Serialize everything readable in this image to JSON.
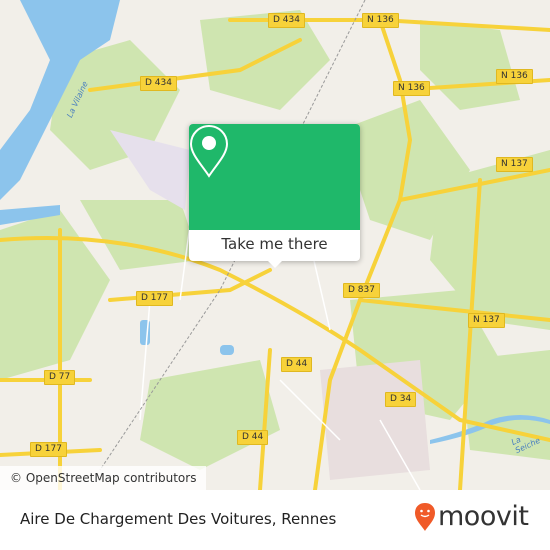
{
  "map": {
    "road_labels": [
      "D 434",
      "N 136",
      "N 136",
      "N 136",
      "D 434",
      "N 137",
      "D 177",
      "D 837",
      "N 137",
      "D 44",
      "D 77",
      "D 34",
      "D 44",
      "D 177"
    ],
    "water_labels": [
      "La Vilaine",
      "La Seiche"
    ],
    "attribution": "© OpenStreetMap contributors",
    "colors": {
      "land": "#f2efe9",
      "forest": "#cfe5b0",
      "water": "#8cc4ec",
      "road": "#f7d23a"
    }
  },
  "popup": {
    "icon": "location-pin-icon",
    "button_label": "Take me there",
    "color": "#1fb86a"
  },
  "footer": {
    "place_name": "Aire De Chargement Des Voitures, Rennes",
    "brand": "moovit",
    "brand_color": "#f05a28"
  }
}
